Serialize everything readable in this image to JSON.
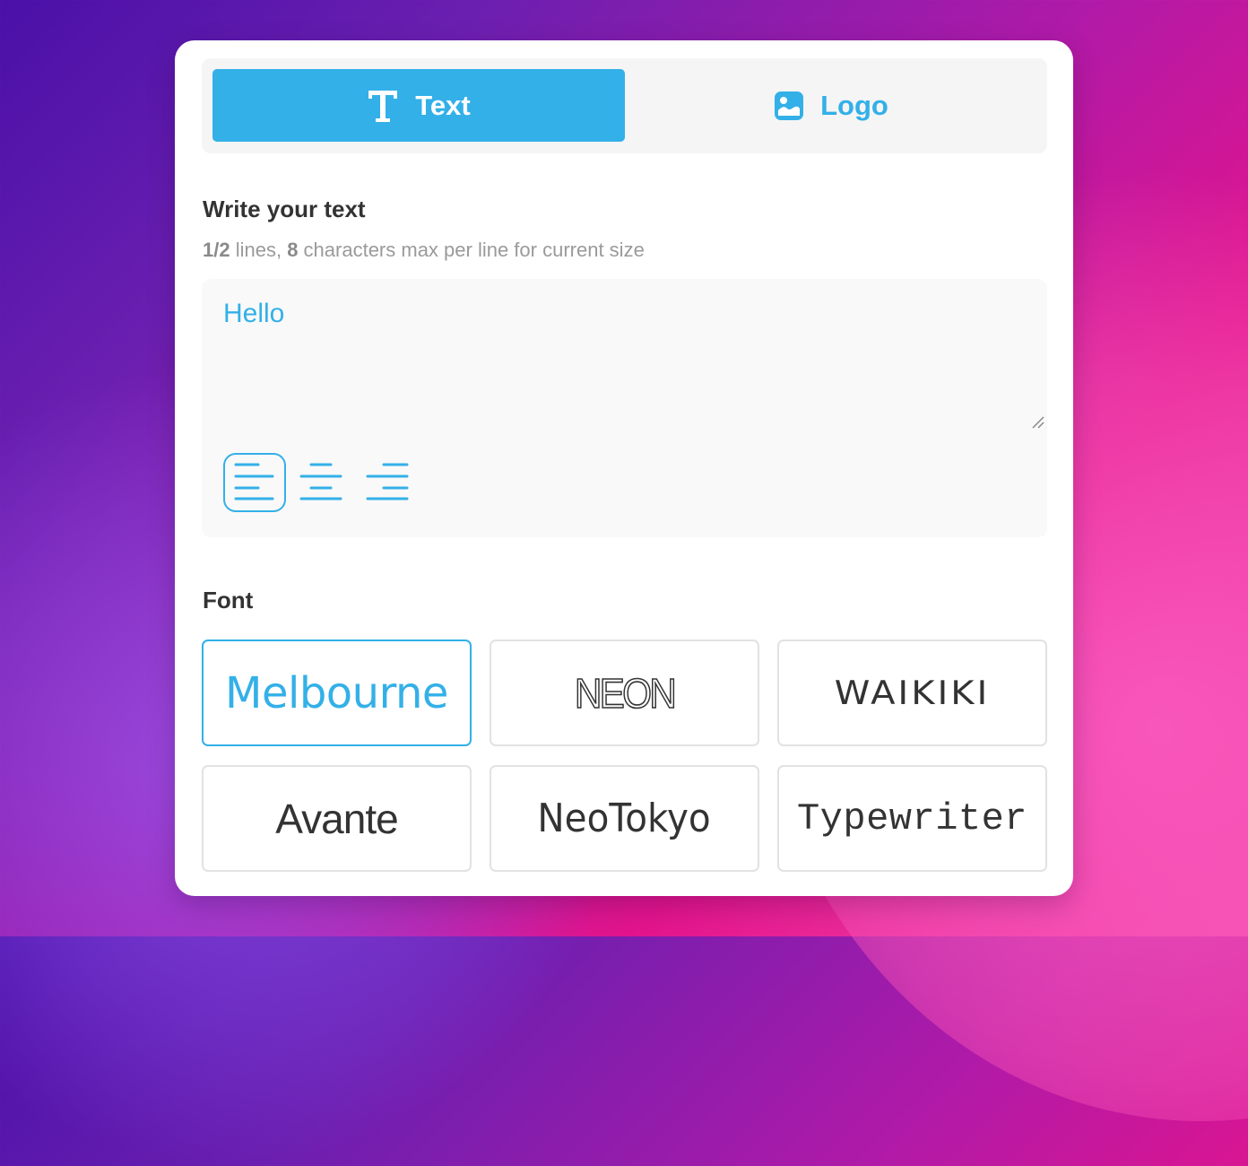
{
  "colors": {
    "accent": "#33b0e8",
    "heading": "#333333",
    "hint": "#9a9a9a",
    "card_border": "#e2e2e2"
  },
  "tabs": [
    {
      "label": "Text",
      "icon": "text-t-icon",
      "active": true
    },
    {
      "label": "Logo",
      "icon": "image-icon",
      "active": false
    }
  ],
  "write_section": {
    "title": "Write your text",
    "hint": {
      "lines_value": "1/2",
      "lines_suffix": " lines, ",
      "chars_value": "8",
      "chars_suffix": " characters max per line for current size"
    },
    "text_value": "Hello",
    "alignment_options": [
      {
        "name": "align-left",
        "icon": "align-left-icon",
        "selected": true
      },
      {
        "name": "align-center",
        "icon": "align-center-icon",
        "selected": false
      },
      {
        "name": "align-right",
        "icon": "align-right-icon",
        "selected": false
      }
    ]
  },
  "font_section": {
    "title": "Font",
    "fonts": [
      {
        "label": "Melbourne",
        "selected": true
      },
      {
        "label": "NEON",
        "selected": false
      },
      {
        "label": "WAIKIKI",
        "selected": false
      },
      {
        "label": "Avante",
        "selected": false
      },
      {
        "label": "NeoTokyo",
        "selected": false
      },
      {
        "label": "Typewriter",
        "selected": false
      }
    ]
  }
}
